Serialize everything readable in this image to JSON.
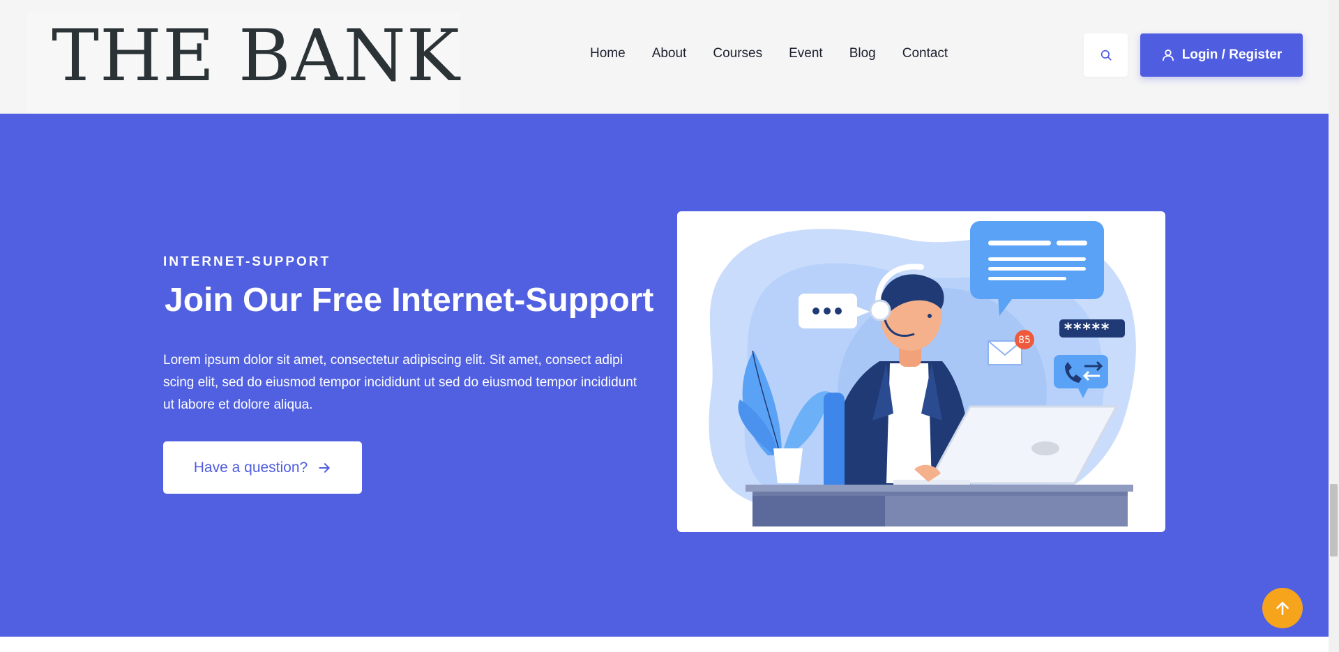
{
  "header": {
    "logo_text": "THE BANK",
    "nav": [
      "Home",
      "About",
      "Courses",
      "Event",
      "Blog",
      "Contact"
    ],
    "login_label": "Login / Register",
    "search_icon": "search-icon",
    "user_icon": "user-icon"
  },
  "hero": {
    "eyebrow": "INTERNET-SUPPORT",
    "title": "Join Our Free Internet-Support",
    "description": "Lorem ipsum dolor sit amet, consectetur adipiscing elit. Sit amet, consect adipi scing elit, sed do eiusmod tempor incididunt ut sed do eiusmod tempor incididunt ut labore et dolore aliqua.",
    "cta_label": "Have a question?",
    "cta_icon": "arrow-right-icon"
  },
  "illustration": {
    "notification_count": "85",
    "password_mask": "*****"
  },
  "colors": {
    "brand": "#4f5de0",
    "hero_bg": "#5060e0",
    "accent": "#f7a41d"
  }
}
